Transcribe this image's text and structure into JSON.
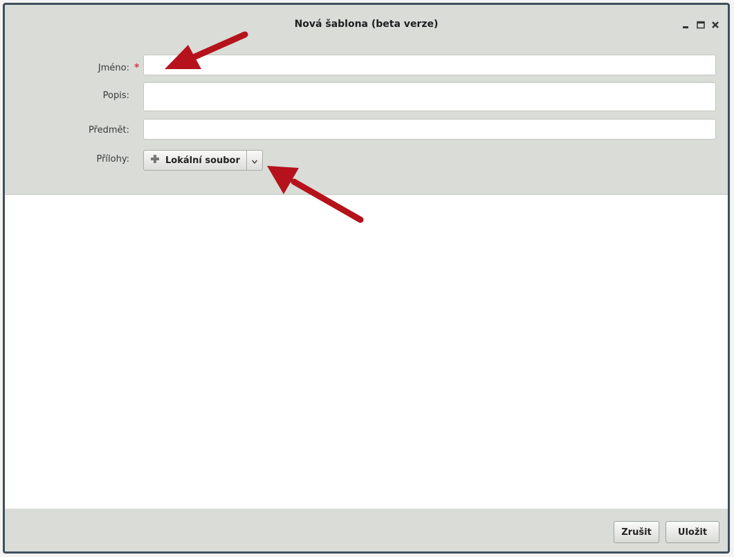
{
  "window": {
    "title": "Nová šablona (beta verze)",
    "controls": [
      "minimize-icon",
      "maximize-icon",
      "close-icon"
    ]
  },
  "form": {
    "name_label": "Jméno:",
    "name_required_mark": "*",
    "name_value": "",
    "description_label": "Popis:",
    "description_value": "",
    "subject_label": "Předmět:",
    "subject_value": "",
    "attachments_label": "Přílohy:",
    "attachment_button_label": "Lokální soubor",
    "attachment_button_icon": "plus-icon",
    "attachment_dropdown_icon": "chevron-down-icon"
  },
  "footer": {
    "cancel_label": "Zrušit",
    "save_label": "Uložit"
  },
  "colors": {
    "window_border": "#3d4f5b",
    "panel_bg": "#d9dcd7",
    "required": "#d23a4a",
    "annotation_arrow": "#b5121b"
  }
}
